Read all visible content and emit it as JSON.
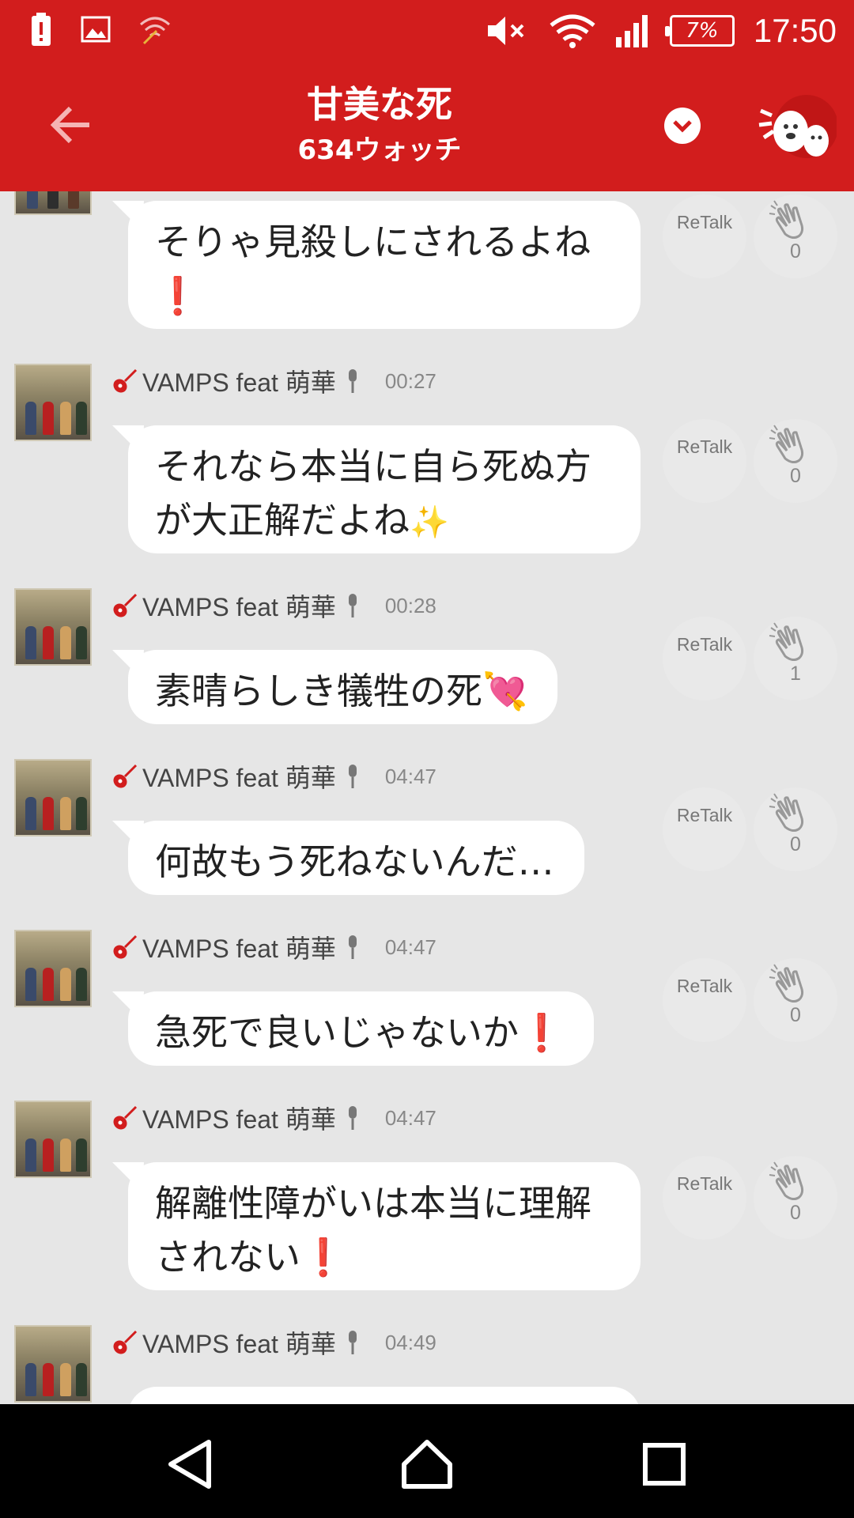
{
  "status_bar": {
    "battery": "7%",
    "time": "17:50",
    "icons": [
      "alert-icon",
      "image-icon",
      "wifi-off-icon",
      "mute-icon",
      "wifi-icon",
      "signal-icon",
      "battery-icon"
    ]
  },
  "header": {
    "title": "甘美な死",
    "subtitle": "634ウォッチ"
  },
  "posts": [
    {
      "user": "",
      "time": "",
      "text": "そりゃ見殺しにされるよね",
      "suffix": "❗",
      "retalk": "ReTalk",
      "claps": "0"
    },
    {
      "user": "VAMPS feat 萌華",
      "time": "00:27",
      "text": "それなら本当に自ら死ぬ方が大正解だよね",
      "suffix": "✨",
      "retalk": "ReTalk",
      "claps": "0"
    },
    {
      "user": "VAMPS feat 萌華",
      "time": "00:28",
      "text": "素晴らしき犠牲の死",
      "suffix": "💘",
      "retalk": "ReTalk",
      "claps": "1"
    },
    {
      "user": "VAMPS feat 萌華",
      "time": "04:47",
      "text": "何故もう死ねないんだ…",
      "suffix": "",
      "retalk": "ReTalk",
      "claps": "0"
    },
    {
      "user": "VAMPS feat 萌華",
      "time": "04:47",
      "text": "急死で良いじゃないか",
      "suffix": "❗",
      "retalk": "ReTalk",
      "claps": "0"
    },
    {
      "user": "VAMPS feat 萌華",
      "time": "04:47",
      "text": "解離性障がいは本当に理解されない",
      "suffix": "❗",
      "retalk": "ReTalk",
      "claps": "0"
    },
    {
      "user": "VAMPS feat 萌華",
      "time": "04:49",
      "text": "",
      "suffix": "",
      "retalk": "",
      "claps": ""
    }
  ],
  "colors": {
    "header_bg": "#d21d1d",
    "feed_bg": "#e6e6e6",
    "bubble_bg": "#ffffff",
    "accent_red": "#e01010"
  }
}
